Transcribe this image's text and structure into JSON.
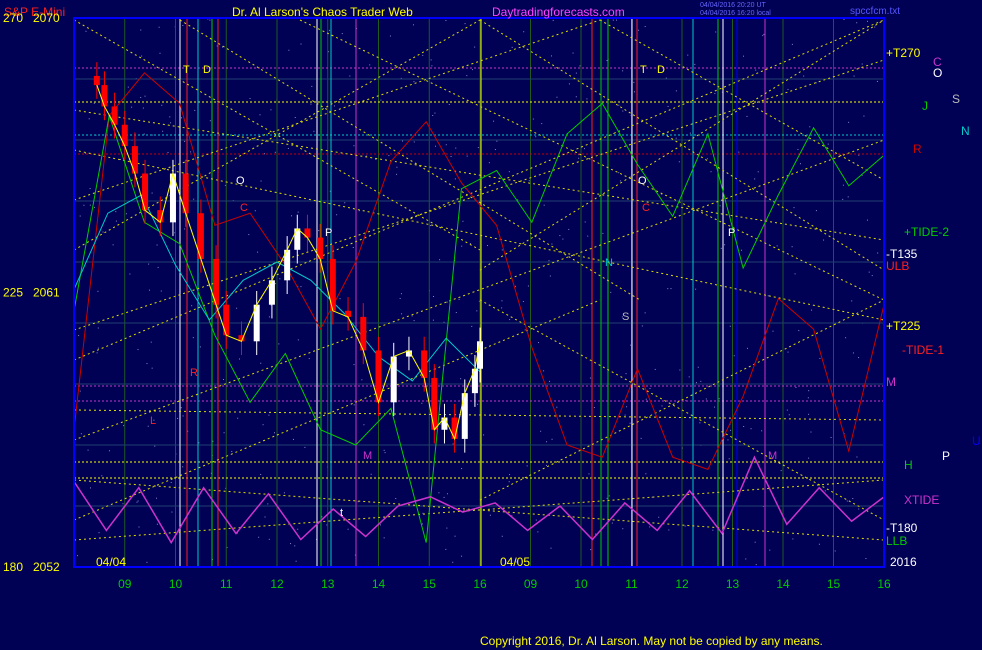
{
  "header": {
    "instrument": "S&P E-Mini",
    "title": "Dr. Al Larson's Chaos Trader Web",
    "site": "Daytradingforecasts.com",
    "stamp1": "04/04/2016 20:20 UT",
    "stamp2": "04/04/2016 16:20 local",
    "file": "spccfcm.txt"
  },
  "footer": {
    "copyright": "Copyright 2016, Dr. Al Larson. May not be copied by any means."
  },
  "colors": {
    "background": "#000055",
    "frame": "#0000ff",
    "price_up": "#ffffff",
    "price_down": "#ff0000",
    "tide_cyan": "#00cccc",
    "tide_green": "#00cc00",
    "tide_red": "#cc0000",
    "xtide": "#cc33cc",
    "grid": "#ffff00",
    "label_yellow": "#ffff00"
  },
  "chart_data": {
    "type": "line",
    "title": "S&P E-Mini",
    "ylim": [
      2052,
      2070
    ],
    "y_ticks": [
      {
        "left": "270",
        "price": "2070",
        "value": 2070
      },
      {
        "left": "225",
        "price": "2061",
        "value": 2061
      },
      {
        "left": "180",
        "price": "2052",
        "value": 2052
      }
    ],
    "x_hours": [
      "09",
      "10",
      "11",
      "12",
      "13",
      "14",
      "15",
      "16",
      "09",
      "10",
      "11",
      "12",
      "13",
      "14",
      "15",
      "16"
    ],
    "date_labels": [
      "04/04",
      "04/05"
    ],
    "year": "2016",
    "price_close": [
      2067.8,
      2067.1,
      2066.5,
      2065.8,
      2064.9,
      2063.7,
      2063.3,
      2064.9,
      2063.6,
      2062.1,
      2060.6,
      2059.6,
      2059.4,
      2060.6,
      2061.4,
      2062.4,
      2063.1,
      2062.8,
      2062.1,
      2060.4,
      2060.2,
      2059.1,
      2057.4,
      2058.9,
      2059.1,
      2058.2,
      2056.5,
      2056.9,
      2056.2,
      2057.7,
      2058.5,
      2059.4
    ],
    "price_hours": [
      8.45,
      8.6,
      8.8,
      9.0,
      9.2,
      9.4,
      9.7,
      9.95,
      10.2,
      10.5,
      10.8,
      11.0,
      11.3,
      11.6,
      11.9,
      12.2,
      12.4,
      12.6,
      12.85,
      13.1,
      13.4,
      13.7,
      14.0,
      14.3,
      14.6,
      14.9,
      15.1,
      15.3,
      15.5,
      15.7,
      15.9,
      16.0
    ],
    "tide_red_values": [
      2056.5,
      2066.8,
      2068.2,
      2067.2,
      2063.2,
      2063.6,
      2061.9,
      2059.8,
      2062.0,
      2065.3,
      2066.6,
      2064.6,
      2063.2,
      2059.2,
      2056.0,
      2055.6,
      2058.5,
      2055.6,
      2055.2,
      2057.6,
      2060.8,
      2059.8,
      2055.8,
      2060.6
    ],
    "tide_green_values": [
      2060.4,
      2066.8,
      2063.3,
      2062.6,
      2059.6,
      2057.4,
      2059.0,
      2056.5,
      2056.0,
      2057.2,
      2052.8,
      2064.4,
      2065.0,
      2063.3,
      2066.2,
      2067.2,
      2065.2,
      2063.5,
      2066.2,
      2061.8,
      2064.2,
      2066.4,
      2064.5,
      2065.5
    ],
    "tide_cyan_values": [
      2061.1,
      2063.6,
      2064.2,
      2061.9,
      2060.1,
      2061.4,
      2062.0,
      2061.4,
      2060.3,
      2058.9,
      2058.1,
      2059.5,
      2058.4
    ],
    "xtide_values": [
      2054.8,
      2053.2,
      2054.6,
      2052.8,
      2054.6,
      2053.1,
      2054.4,
      2052.9,
      2053.9,
      2053.0,
      2054.0,
      2054.3,
      2053.8,
      2054.1,
      2053.2,
      2054.0,
      2052.9,
      2054.1,
      2053.2,
      2054.5,
      2053.1,
      2055.6,
      2053.4,
      2054.6,
      2053.5,
      2054.3
    ]
  },
  "right_labels": [
    {
      "text": "+T270",
      "color": "#ffff00"
    },
    {
      "text": "+TIDE-2",
      "color": "#00cc00"
    },
    {
      "text": "-T135",
      "color": "#ffffff"
    },
    {
      "text": "ULB",
      "color": "#ff2020"
    },
    {
      "text": "+T225",
      "color": "#ffff00"
    },
    {
      "text": "-TIDE-1",
      "color": "#ff2020"
    },
    {
      "text": "M",
      "color": "#cc33cc"
    },
    {
      "text": "H",
      "color": "#00cc00"
    },
    {
      "text": "XTIDE",
      "color": "#cc33cc"
    },
    {
      "text": "-T180",
      "color": "#ffffff"
    },
    {
      "text": "LLB",
      "color": "#00cc00"
    }
  ],
  "planet_labels": [
    {
      "text": "C",
      "color": "#cc33cc"
    },
    {
      "text": "O",
      "color": "#ffffff"
    },
    {
      "text": "S",
      "color": "#bbbbbb"
    },
    {
      "text": "J",
      "color": "#00cc00"
    },
    {
      "text": "N",
      "color": "#00cccc"
    },
    {
      "text": "R",
      "color": "#cc0000"
    },
    {
      "text": "P",
      "color": "#ffffff"
    },
    {
      "text": "U",
      "color": "#0000ff"
    }
  ],
  "chart_letters": [
    "T",
    "D",
    "O",
    "C",
    "N",
    "S",
    "R",
    "P",
    "t",
    "M",
    "L"
  ]
}
